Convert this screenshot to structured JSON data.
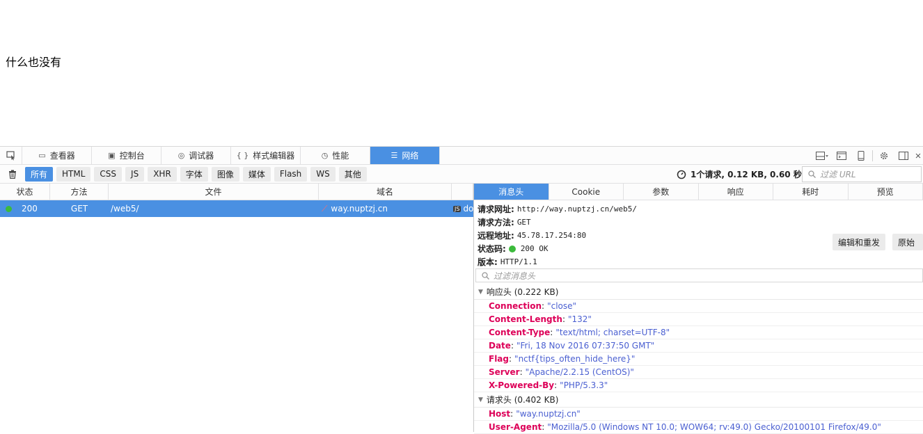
{
  "page": {
    "text": "什么也没有"
  },
  "toolbar": {
    "tabs": [
      {
        "label": "查看器",
        "icon": "inspector-icon"
      },
      {
        "label": "控制台",
        "icon": "console-icon"
      },
      {
        "label": "调试器",
        "icon": "debugger-icon"
      },
      {
        "label": "样式编辑器",
        "icon": "style-editor-icon"
      },
      {
        "label": "性能",
        "icon": "performance-icon"
      },
      {
        "label": "网络",
        "icon": "network-icon",
        "active": true
      }
    ]
  },
  "filters": {
    "buttons": [
      "所有",
      "HTML",
      "CSS",
      "JS",
      "XHR",
      "字体",
      "图像",
      "媒体",
      "Flash",
      "WS",
      "其他"
    ],
    "active": "所有",
    "summary": "1个请求, 0.12 KB, 0.60 秒",
    "url_placeholder": "过滤 URL"
  },
  "requests": {
    "columns": [
      "状态",
      "方法",
      "文件",
      "域名"
    ],
    "rows": [
      {
        "status": "200",
        "method": "GET",
        "file": "/web5/",
        "domain": "way.nuptzj.cn",
        "type": "do"
      }
    ]
  },
  "details": {
    "tabs": [
      "消息头",
      "Cookie",
      "参数",
      "响应",
      "耗时",
      "预览"
    ],
    "active_tab": "消息头",
    "summary": {
      "url_label": "请求网址:",
      "url": "http://way.nuptzj.cn/web5/",
      "method_label": "请求方法:",
      "method": "GET",
      "remote_label": "远程地址:",
      "remote": "45.78.17.254:80",
      "status_label": "状态码:",
      "status": "200 OK",
      "version_label": "版本:",
      "version": "HTTP/1.1"
    },
    "edit_resend": "编辑和重发",
    "raw_headers": "原始",
    "filter_placeholder": "过滤消息头",
    "response_headers_title": "响应头 (0.222 KB)",
    "response_headers": [
      {
        "name": "Connection",
        "value": "\"close\""
      },
      {
        "name": "Content-Length",
        "value": "\"132\""
      },
      {
        "name": "Content-Type",
        "value": "\"text/html; charset=UTF-8\""
      },
      {
        "name": "Date",
        "value": "\"Fri, 18 Nov 2016 07:37:50 GMT\""
      },
      {
        "name": "Flag",
        "value": "\"nctf{tips_often_hide_here}\""
      },
      {
        "name": "Server",
        "value": "\"Apache/2.2.15 (CentOS)\""
      },
      {
        "name": "X-Powered-By",
        "value": "\"PHP/5.3.3\""
      }
    ],
    "request_headers_title": "请求头 (0.402 KB)",
    "request_headers": [
      {
        "name": "Host",
        "value": "\"way.nuptzj.cn\""
      },
      {
        "name": "User-Agent",
        "value": "\"Mozilla/5.0 (Windows NT 10.0; WOW64; rv:49.0) Gecko/20100101 Firefox/49.0\""
      }
    ]
  }
}
